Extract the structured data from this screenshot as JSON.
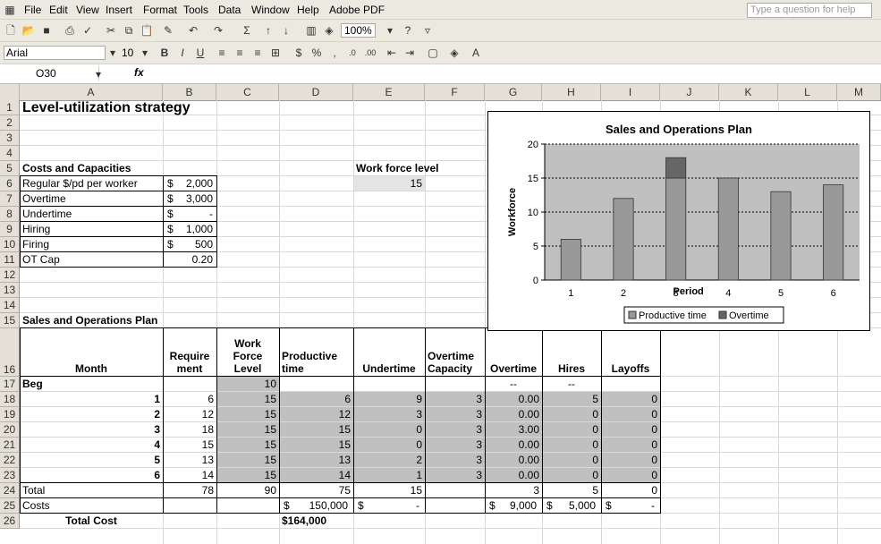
{
  "menu": {
    "items": [
      "File",
      "Edit",
      "View",
      "Insert",
      "Format",
      "Tools",
      "Data",
      "Window",
      "Help",
      "Adobe PDF"
    ],
    "help_placeholder": "Type a question for help"
  },
  "toolbar": {
    "zoom": "100%",
    "font": "Arial",
    "font_size": "10"
  },
  "formula_bar": {
    "name_box": "O30",
    "fx": "fx"
  },
  "columns": [
    "A",
    "B",
    "C",
    "D",
    "E",
    "F",
    "G",
    "H",
    "I",
    "J",
    "K",
    "L",
    "M"
  ],
  "rows": [
    "1",
    "2",
    "3",
    "4",
    "5",
    "6",
    "7",
    "8",
    "9",
    "10",
    "11",
    "12",
    "13",
    "14",
    "15",
    "16",
    "17",
    "18",
    "19",
    "20",
    "21",
    "22",
    "23",
    "24",
    "25",
    "26"
  ],
  "sheet": {
    "title": "Level-utilization strategy",
    "costs_header": "Costs and Capacities",
    "costs": [
      {
        "label": "Regular $/pd per worker",
        "cur": "$",
        "value": "2,000"
      },
      {
        "label": "Overtime",
        "cur": "$",
        "value": "3,000"
      },
      {
        "label": "Undertime",
        "cur": "$",
        "value": "-"
      },
      {
        "label": "Hiring",
        "cur": "$",
        "value": "1,000"
      },
      {
        "label": "Firing",
        "cur": "$",
        "value": "500"
      },
      {
        "label": "OT Cap",
        "cur": "",
        "value": "0.20"
      }
    ],
    "workforce_label": "Work force level",
    "workforce_value": "15",
    "plan_header": "Sales and Operations Plan",
    "table_headers": {
      "month": "Month",
      "requirement": "Require ment",
      "workforce": "Work Force Level",
      "productive": "Productive time",
      "undertime": "Undertime",
      "ot_capacity": "Overtime Capacity",
      "overtime": "Overtime",
      "hires": "Hires",
      "layoffs": "Layoffs"
    },
    "beg_row": {
      "label": "Beg",
      "workforce": "10",
      "overtime": "--",
      "hires": "--"
    },
    "plan_rows": [
      {
        "month": "1",
        "req": "6",
        "wf": "15",
        "prod": "6",
        "under": "9",
        "otcap": "3",
        "ot": "0.00",
        "hires": "5",
        "layoffs": "0"
      },
      {
        "month": "2",
        "req": "12",
        "wf": "15",
        "prod": "12",
        "under": "3",
        "otcap": "3",
        "ot": "0.00",
        "hires": "0",
        "layoffs": "0"
      },
      {
        "month": "3",
        "req": "18",
        "wf": "15",
        "prod": "15",
        "under": "0",
        "otcap": "3",
        "ot": "3.00",
        "hires": "0",
        "layoffs": "0"
      },
      {
        "month": "4",
        "req": "15",
        "wf": "15",
        "prod": "15",
        "under": "0",
        "otcap": "3",
        "ot": "0.00",
        "hires": "0",
        "layoffs": "0"
      },
      {
        "month": "5",
        "req": "13",
        "wf": "15",
        "prod": "13",
        "under": "2",
        "otcap": "3",
        "ot": "0.00",
        "hires": "0",
        "layoffs": "0"
      },
      {
        "month": "6",
        "req": "14",
        "wf": "15",
        "prod": "14",
        "under": "1",
        "otcap": "3",
        "ot": "0.00",
        "hires": "0",
        "layoffs": "0"
      }
    ],
    "total_row": {
      "label": "Total",
      "req": "78",
      "wf": "90",
      "prod": "75",
      "under": "15",
      "ot": "3",
      "hires": "5",
      "layoffs": "0"
    },
    "costs_row": {
      "label": "Costs",
      "prod_cur": "$",
      "prod": "150,000",
      "under_cur": "$",
      "under": "-",
      "ot_cur": "$",
      "ot": "9,000",
      "hires_cur": "$",
      "hires": "5,000",
      "layoffs_cur": "$",
      "layoffs": "-"
    },
    "total_cost_label": "Total Cost",
    "total_cost_value": "$164,000"
  },
  "chart_data": {
    "type": "bar",
    "title": "Sales and Operations Plan",
    "xlabel": "Period",
    "ylabel": "Workforce",
    "categories": [
      "1",
      "2",
      "3",
      "4",
      "5",
      "6"
    ],
    "ylim": [
      0,
      20
    ],
    "yticks": [
      "0",
      "5",
      "10",
      "15",
      "20"
    ],
    "stacked": true,
    "grid": "dashed horizontal",
    "legend_position": "bottom",
    "series": [
      {
        "name": "Productive time",
        "values": [
          6,
          12,
          15,
          15,
          13,
          14
        ],
        "color": "#999999"
      },
      {
        "name": "Overtime",
        "values": [
          0,
          0,
          3,
          0,
          0,
          0
        ],
        "color": "#666666"
      }
    ],
    "plot_bg": "#c0c0c0"
  }
}
